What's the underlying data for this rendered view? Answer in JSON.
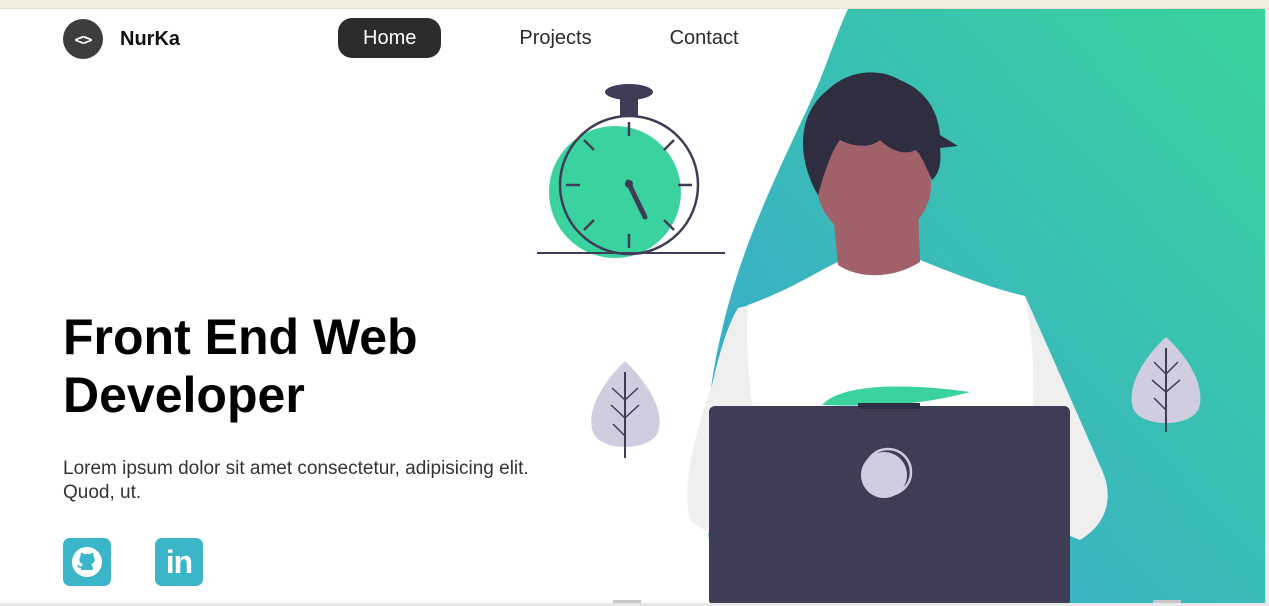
{
  "brand": {
    "logo_glyph": "<>",
    "name": "NurKa"
  },
  "nav": {
    "items": [
      {
        "label": "Home",
        "active": true
      },
      {
        "label": "Projects",
        "active": false
      },
      {
        "label": "Contact",
        "active": false
      }
    ]
  },
  "hero": {
    "title": "Front End Web Developer",
    "description": "Lorem ipsum dolor sit amet consectetur, adipisicing elit. Quod, ut."
  },
  "social": [
    {
      "icon": "github-icon"
    },
    {
      "icon": "linkedin-icon",
      "glyph": "in"
    }
  ],
  "colors": {
    "accent_green": "#3ad29f",
    "accent_blue": "#3ba4d6",
    "dark": "#2c2c2c",
    "laptop": "#3f3d56",
    "leaf": "#d0cde1"
  }
}
